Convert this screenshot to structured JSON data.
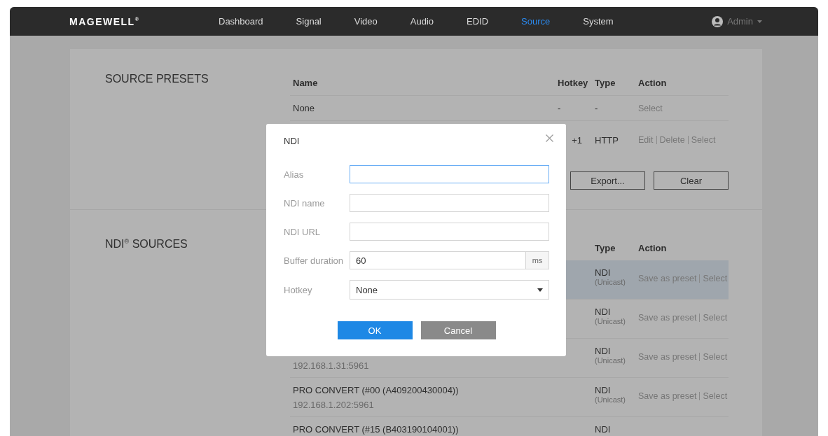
{
  "nav": {
    "logo": "MAGEWELL$^{®}$",
    "items": [
      {
        "label": "Dashboard",
        "selected": false
      },
      {
        "label": "Signal",
        "selected": false
      },
      {
        "label": "Video",
        "selected": false
      },
      {
        "label": "Audio",
        "selected": false
      },
      {
        "label": "EDID",
        "selected": false
      },
      {
        "label": "Source",
        "selected": true
      },
      {
        "label": "System",
        "selected": false
      }
    ],
    "user": "Admin"
  },
  "source_presets": {
    "title": "SOURCE PRESETS",
    "columns": [
      "Name",
      "Hotkey",
      "Type",
      "Action"
    ],
    "rows": [
      {
        "name": "None",
        "hotkey": "-",
        "type": "-",
        "actions": [
          "Select"
        ]
      },
      {
        "hotkey": "+1",
        "type": "HTTP",
        "actions": [
          "Edit",
          "Delete",
          "Select"
        ]
      }
    ],
    "buttons": [
      "Export...",
      "Clear"
    ]
  },
  "ndi_sources": {
    "title": "NDI$^{®}$ SOURCES",
    "columns": [
      "Type",
      "Action"
    ],
    "rows": [
      {
        "type": "NDI",
        "mode": "(Unicast)",
        "actions": [
          "Save as preset",
          "Select"
        ],
        "selected": true
      },
      {
        "type": "NDI",
        "mode": "(Unicast)",
        "actions": [
          "Save as preset",
          "Select"
        ],
        "selected": false
      },
      {
        "address": "192.168.1.31:5961",
        "type": "NDI",
        "mode": "(Unicast)",
        "actions": [
          "Save as preset",
          "Select"
        ],
        "selected": false
      },
      {
        "name": "PRO CONVERT (#00 (A409200430004))",
        "address": "192.168.1.202:5961",
        "type": "NDI",
        "mode": "(Unicast)",
        "actions": [
          "Save as preset",
          "Select"
        ],
        "selected": false
      },
      {
        "name": "PRO CONVERT (#15 (B403190104001))",
        "type": "NDI",
        "selected": false
      }
    ]
  },
  "dialog": {
    "title": "NDI",
    "fields": [
      {
        "label": "Alias",
        "kind": "text",
        "focused": true
      },
      {
        "label": "NDI name",
        "kind": "text",
        "focused": false
      },
      {
        "label": "NDI URL",
        "kind": "text",
        "focused": false
      },
      {
        "label": "Buffer duration",
        "kind": "number",
        "value": "60",
        "unit": "ms",
        "focused": false
      },
      {
        "label": "Hotkey",
        "kind": "select",
        "value": "None",
        "focused": false
      }
    ],
    "buttons": [
      {
        "label": "OK",
        "kind": "primary"
      },
      {
        "label": "Cancel",
        "kind": "secondary"
      }
    ]
  }
}
